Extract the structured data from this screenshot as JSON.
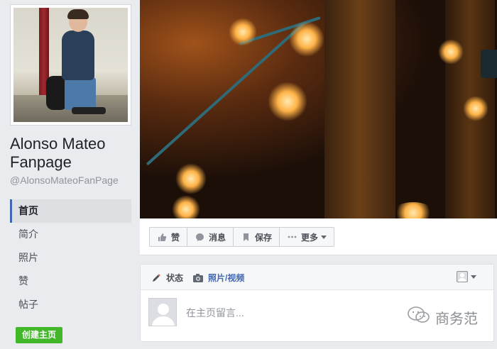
{
  "page": {
    "name": "Alonso Mateo Fanpage",
    "handle": "@AlonsoMateoFanPage"
  },
  "nav": {
    "items": [
      {
        "label": "首页",
        "active": true
      },
      {
        "label": "简介",
        "active": false
      },
      {
        "label": "照片",
        "active": false
      },
      {
        "label": "赞",
        "active": false
      },
      {
        "label": "帖子",
        "active": false
      }
    ]
  },
  "create_page_label": "创建主页",
  "actions": {
    "like": "赞",
    "message": "消息",
    "save": "保存",
    "more": "更多"
  },
  "composer": {
    "status_tab": "状态",
    "media_tab": "照片/视频",
    "placeholder": "在主页留言..."
  },
  "watermark": "商务范",
  "colors": {
    "brand_blue": "#4267b2",
    "create_green": "#42b72a",
    "background": "#e9ebee"
  }
}
